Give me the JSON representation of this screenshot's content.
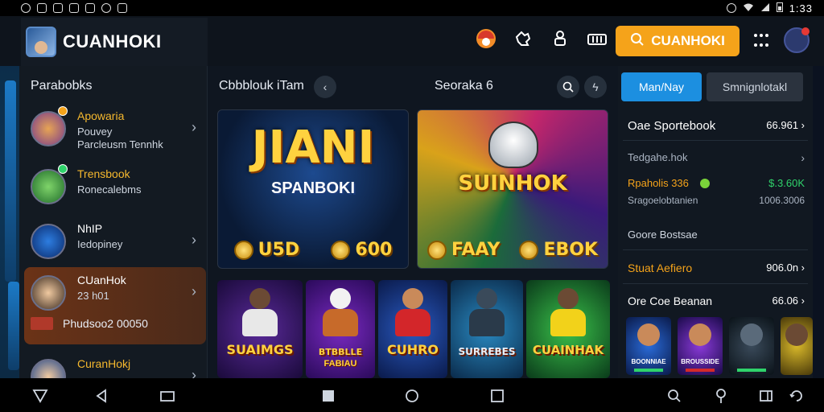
{
  "status": {
    "time": "1:33"
  },
  "brand": {
    "name": "CUANHOKI"
  },
  "header": {
    "search_label": "CUANHOKI"
  },
  "sidebar": {
    "title": "Parabobks",
    "items": [
      {
        "title": "Apowaria",
        "sub": "Pouvey",
        "sub2": "Parcleusm Tennhk"
      },
      {
        "title": "Trensbook",
        "sub": "Ronecalebms",
        "sub2": ""
      },
      {
        "title": "NhIP",
        "sub": "Iedopiney",
        "sub2": ""
      },
      {
        "title": "CUanHok",
        "sub": "23 h01",
        "sub2": ""
      },
      {
        "title": "CuranHokj",
        "sub": "",
        "sub2": ""
      }
    ],
    "extra": "Phudsoo2 00050"
  },
  "main": {
    "section_left": "Cbbblouk iTam",
    "section_right": "Seoraka 6",
    "promos": [
      {
        "title": "JIANI",
        "sub": "SPANBOKI",
        "coin_left": "U5D",
        "coin_right": "600"
      },
      {
        "title": "SUINHOK",
        "sub": "",
        "coin_left": "FAAY",
        "coin_right": "EBOK"
      }
    ],
    "tiles": [
      {
        "label": "SUAIMGS",
        "label2": ""
      },
      {
        "label": "BTBBLLE",
        "label2": "FABIAU"
      },
      {
        "label": "CUHRO",
        "label2": ""
      },
      {
        "label": "SURREBES",
        "label2": ""
      },
      {
        "label": "CUAINHAK",
        "label2": ""
      }
    ]
  },
  "right_panel": {
    "tab_active": "Man/Nay",
    "tab_inactive": "Smnignlotakl",
    "rows": [
      {
        "label": "Oae Sportebook",
        "value": "66.961"
      },
      {
        "label": "Tedgahe.hok",
        "value": ""
      },
      {
        "label": "Rpaholis 336",
        "value": "$.3.60K"
      },
      {
        "label": "Sragoelobtanien",
        "value": "1006.3006"
      },
      {
        "label": "Goore Bostsae",
        "value": ""
      },
      {
        "label": "Stuat Aefiero",
        "value": "906.0n"
      },
      {
        "label": "Ore Coe Beanan",
        "value": "66.06"
      }
    ],
    "thumbs": [
      {
        "l1": "BOONNIAE",
        "l2": ""
      },
      {
        "l1": "BROUSSIDE",
        "l2": ""
      },
      {
        "l1": "",
        "l2": ""
      },
      {
        "l1": "",
        "l2": ""
      }
    ]
  },
  "colors": {
    "accent": "#f5a31a",
    "blue": "#1c8fe0",
    "green": "#2fd36b",
    "gold": "#ffd23f"
  }
}
